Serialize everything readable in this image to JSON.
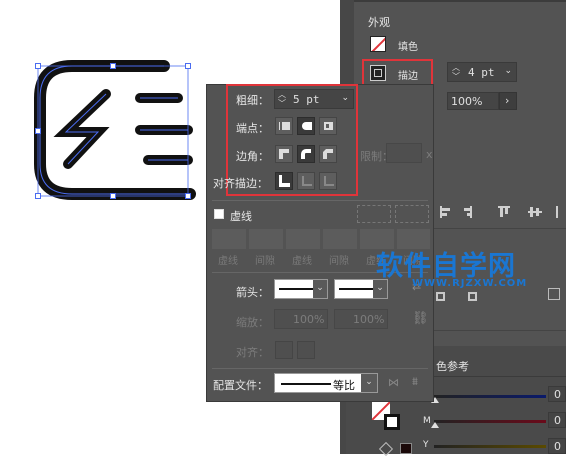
{
  "appearance": {
    "title": "外观",
    "fill_label": "填色",
    "stroke_label": "描边",
    "stroke_weight": "4 pt",
    "opacity": "100%"
  },
  "stroke_panel": {
    "weight_label": "粗细：",
    "weight_value": "5 pt",
    "cap_label": "端点：",
    "corner_label": "边角：",
    "limit_label": "限制：",
    "limit_suffix": "x",
    "align_label": "对齐描边：",
    "dashed_label": "虚线",
    "dash_cells": [
      "虚线",
      "间隙",
      "虚线",
      "间隙",
      "虚线",
      "间隙"
    ],
    "arrow_label": "箭头：",
    "scale_label": "缩放：",
    "scale_left": "100%",
    "scale_right": "100%",
    "arrow_align_label": "对齐：",
    "profile_label": "配置文件：",
    "profile_value": "等比"
  },
  "color_guide": {
    "tab_label": "色参考",
    "rows": [
      {
        "label": "",
        "value": "0"
      },
      {
        "label": "M",
        "value": "0"
      },
      {
        "label": "Y",
        "value": "0"
      }
    ]
  },
  "watermark": {
    "text": "软件自学网",
    "url": "WWW.RJZXW.COM"
  },
  "colors": {
    "accent_red": "#e0343a",
    "watermark_blue": "#1a76d2",
    "selection_blue": "#4a6cf0",
    "panel_bg": "#535353"
  }
}
